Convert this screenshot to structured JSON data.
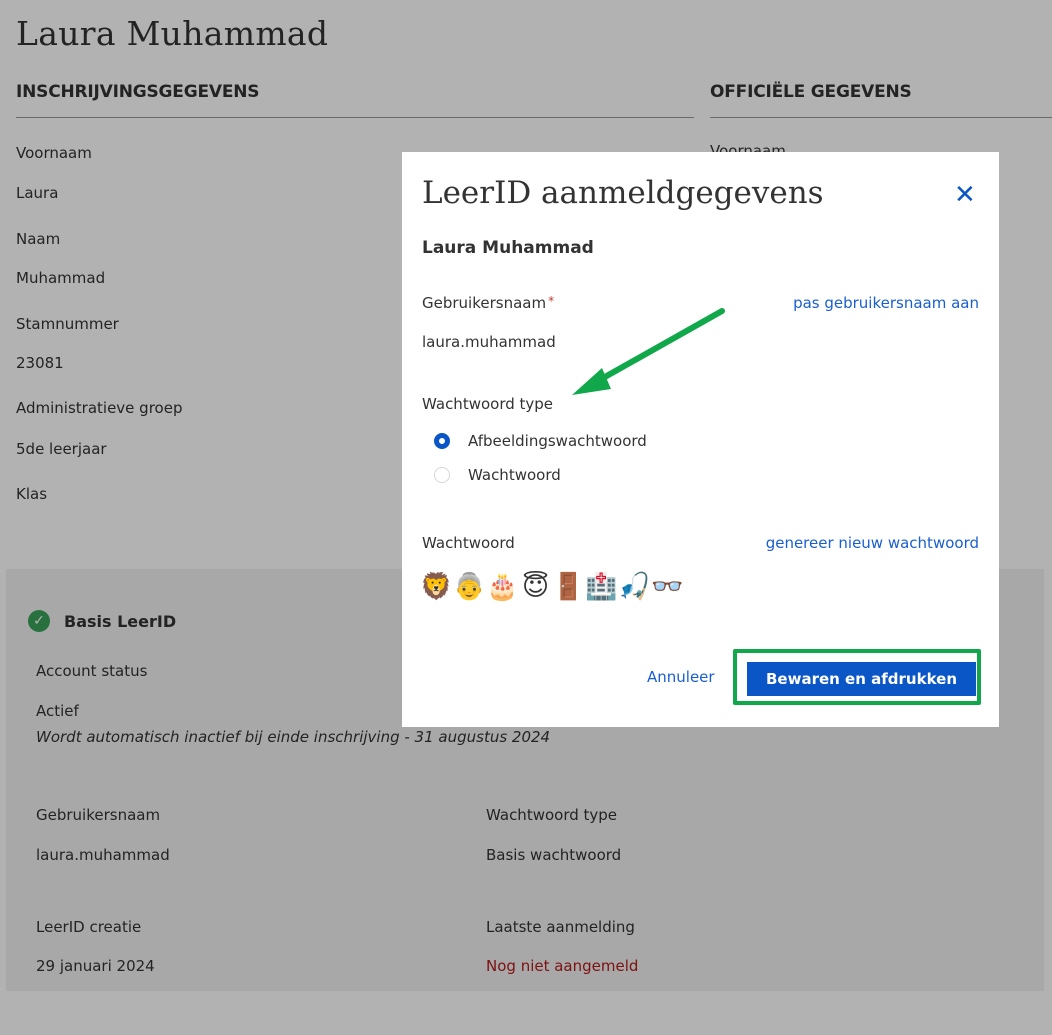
{
  "page": {
    "title": "Laura Muhammad",
    "inschrijving_heading": "INSCHRIJVINGSGEGEVENS",
    "officieel_heading": "OFFICIËLE GEGEVENS",
    "officieel_first_label": "Voornaam",
    "fields": [
      {
        "label": "Voornaam",
        "value": "Laura"
      },
      {
        "label": "Naam",
        "value": "Muhammad"
      },
      {
        "label": "Stamnummer",
        "value": "23081"
      },
      {
        "label": "Administratieve groep",
        "value": "5de leerjaar"
      },
      {
        "label": "Klas",
        "value": ""
      }
    ]
  },
  "account": {
    "title": "Basis LeerID",
    "status_label": "Account status",
    "status_value": "Actief",
    "status_note": "Wordt automatisch inactief bij einde inschrijving - 31 augustus 2024",
    "username_label": "Gebruikersnaam",
    "username_value": "laura.muhammad",
    "pwtype_label": "Wachtwoord type",
    "pwtype_value": "Basis wachtwoord",
    "created_label": "LeerID creatie",
    "created_value": "29 januari 2024",
    "lastlogin_label": "Laatste aanmelding",
    "lastlogin_value": "Nog niet aangemeld",
    "status_color": "#3aa25a"
  },
  "modal": {
    "title": "LeerID aanmeldgegevens",
    "close_icon": "close-icon",
    "student_name": "Laura Muhammad",
    "username_label": "Gebruikersnaam",
    "required_mark": "*",
    "edit_username_link": "pas gebruikersnaam aan",
    "username_value": "laura.muhammad",
    "pwtype_label": "Wachtwoord type",
    "pwtype_options": [
      {
        "label": "Afbeeldingswachtwoord",
        "selected": true
      },
      {
        "label": "Wachtwoord",
        "selected": false
      }
    ],
    "password_label": "Wachtwoord",
    "generate_link": "genereer nieuw wachtwoord",
    "password_emojis": [
      "🦁",
      "👵",
      "🎂",
      "😇",
      "🚪",
      "🏥",
      "🎣",
      "👓"
    ],
    "cancel_label": "Annuleer",
    "save_label": "Bewaren en afdrukken",
    "accent_color": "#0b56c6",
    "highlight_color": "#10a84a"
  }
}
